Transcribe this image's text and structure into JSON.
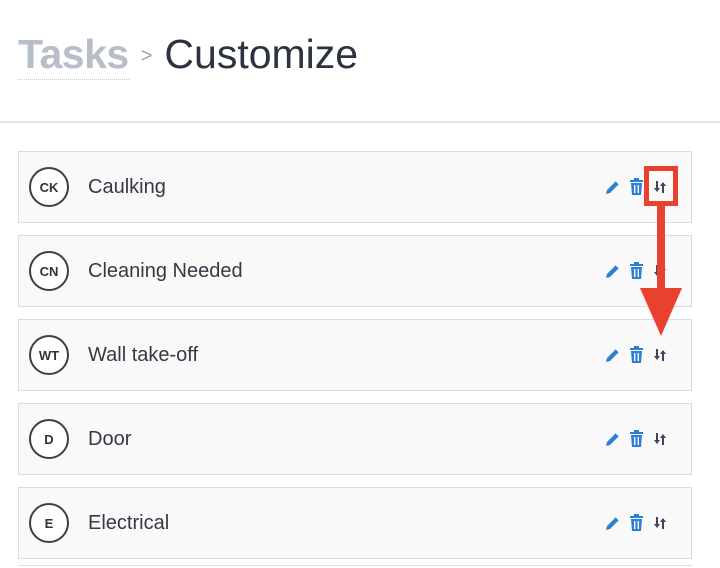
{
  "breadcrumb": {
    "root": "Tasks",
    "separator": ">",
    "current": "Customize"
  },
  "tasks": [
    {
      "initials": "CK",
      "name": "Caulking"
    },
    {
      "initials": "CN",
      "name": "Cleaning Needed"
    },
    {
      "initials": "WT",
      "name": "Wall take-off"
    },
    {
      "initials": "D",
      "name": "Door"
    },
    {
      "initials": "E",
      "name": "Electrical"
    }
  ],
  "row_actions": [
    "pencil-icon",
    "trash-icon",
    "sort-icon"
  ],
  "colors": {
    "action_blue": "#2d7fd4",
    "sort_icon": "#3c4656",
    "annotation_red": "#e8412f",
    "crumb_root": "#b5bec9"
  }
}
